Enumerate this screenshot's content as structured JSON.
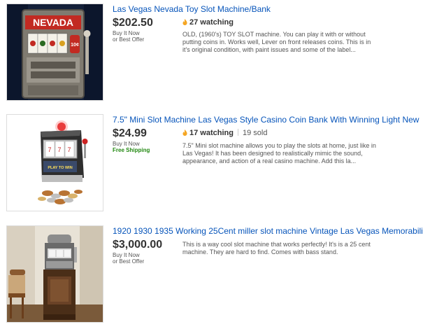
{
  "listings": [
    {
      "title": "Las Vegas Nevada Toy Slot Machine/Bank",
      "price": "$202.50",
      "format_line1": "Buy It Now",
      "format_line2": "or Best Offer",
      "watching": "27 watching",
      "description": "OLD, (1960's) TOY SLOT machine. You can play it with or without putting coins in. Works well, Lever on front releases coins. This is in it's original condition, with paint issues and some of the label...",
      "image_sign": "NEVADA",
      "image_badge": "10¢"
    },
    {
      "title": "7.5\" Mini Slot Machine Las Vegas Style Casino Coin Bank With Winning Light New",
      "price": "$24.99",
      "format_line1": "Buy It Now",
      "shipping": "Free Shipping",
      "watching": "17 watching",
      "sold": "19 sold",
      "description": "7.5\" Mini slot machine allows you to play the slots at home, just like in Las Vegas! It has been designed to realistically mimic the sound, appearance, and action of a real casino machine. Add this la...",
      "image_panel": "PLAY TO WIN"
    },
    {
      "title": "1920 1930 1935 Working 25Cent miller slot machine Vintage Las Vegas Memorabilia",
      "price": "$3,000.00",
      "format_line1": "Buy It Now",
      "format_line2": "or Best Offer",
      "description": "This is a way cool slot machine that works perfectly! It's is a 25 cent machine. They are hard to find. Comes with bass stand."
    }
  ],
  "colors": {
    "link": "#0654ba",
    "price": "#333333",
    "shipping": "#228811",
    "flame": "#f5a623"
  },
  "icons": [
    "flame-icon"
  ]
}
